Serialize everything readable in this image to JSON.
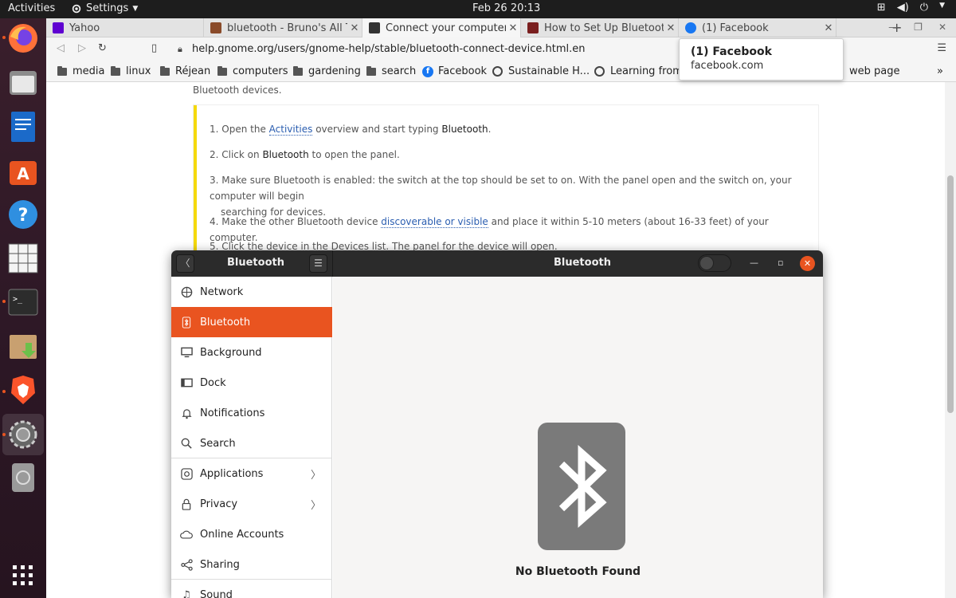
{
  "topbar": {
    "activities": "Activities",
    "app_menu": "Settings",
    "clock": "Feb 26  20:13"
  },
  "browser": {
    "tabs": [
      {
        "title": "Yahoo",
        "fav_color": "#5f01d1"
      },
      {
        "title": "bluetooth - Bruno's All Thi",
        "fav_color": "#8a4b2a"
      },
      {
        "title": "Connect your computer to",
        "fav_color": "#333333"
      },
      {
        "title": "How to Set Up Bluetooth i",
        "fav_color": "#7a1f1f"
      },
      {
        "title": "(1) Facebook",
        "fav_color": "#1877f2"
      }
    ],
    "url": "help.gnome.org/users/gnome-help/stable/bluetooth-connect-device.html.en",
    "bookmarks": [
      {
        "label": "media",
        "icon": "folder-icon"
      },
      {
        "label": "linux",
        "icon": "folder-icon"
      },
      {
        "label": "Réjean",
        "icon": "folder-icon"
      },
      {
        "label": "computers",
        "icon": "folder-icon"
      },
      {
        "label": "gardening",
        "icon": "folder-icon"
      },
      {
        "label": "search",
        "icon": "folder-icon"
      },
      {
        "label": "Facebook",
        "icon": "facebook-icon"
      },
      {
        "label": "Sustainable H...",
        "icon": "globe-icon"
      },
      {
        "label": "Learning from...",
        "icon": "globe-icon"
      },
      {
        "label": "web page",
        "icon": "none"
      }
    ],
    "tooltip": {
      "title": "(1) Facebook",
      "domain": "facebook.com"
    }
  },
  "webpage": {
    "intro": "Bluetooth devices.",
    "steps": {
      "s1_pre": "1. Open the ",
      "s1_link": "Activities",
      "s1_mid": " overview and start typing ",
      "s1_bold": "Bluetooth",
      "s1_end": ".",
      "s2_pre": "2. Click on ",
      "s2_bold": "Bluetooth",
      "s2_end": " to open the panel.",
      "s3": "3. Make sure Bluetooth is enabled: the switch at the top should be set to on. With the panel open and the switch on, your computer will begin",
      "s3b": "searching for devices.",
      "s4_pre": "4. Make the other Bluetooth device ",
      "s4_link": "discoverable or visible",
      "s4_end": " and place it within 5-10 meters (about 16-33 feet) of your computer.",
      "s5": "5. Click the device in the Devices list. The panel for the device will open."
    }
  },
  "settings": {
    "sidebar_title": "Bluetooth",
    "main_title": "Bluetooth",
    "bluetooth_switch_on": false,
    "sidebar": [
      {
        "label": "Network",
        "icon": "network-icon"
      },
      {
        "label": "Bluetooth",
        "icon": "bluetooth-icon",
        "selected": true
      },
      {
        "label": "Background",
        "icon": "background-icon"
      },
      {
        "label": "Dock",
        "icon": "dock-icon"
      },
      {
        "label": "Notifications",
        "icon": "bell-icon"
      },
      {
        "label": "Search",
        "icon": "search-icon"
      },
      {
        "label": "Applications",
        "icon": "applications-icon",
        "arrow": true
      },
      {
        "label": "Privacy",
        "icon": "lock-icon",
        "arrow": true
      },
      {
        "label": "Online Accounts",
        "icon": "cloud-icon"
      },
      {
        "label": "Sharing",
        "icon": "share-icon"
      },
      {
        "label": "Sound",
        "icon": "music-note-icon"
      }
    ],
    "empty_state": "No Bluetooth Found"
  },
  "colors": {
    "accent": "#e95420",
    "topbar": "#1d1d1d",
    "highlight_bar": "#f5d90a"
  }
}
